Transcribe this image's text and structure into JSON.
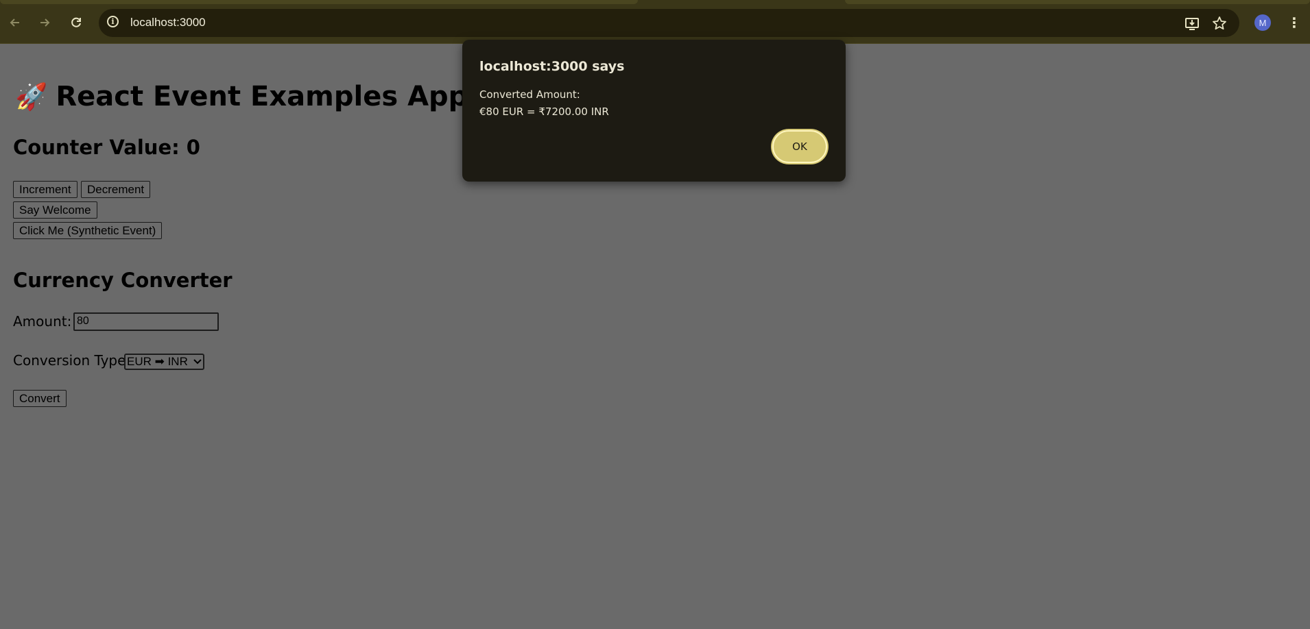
{
  "browser": {
    "url": "localhost:3000",
    "avatar_initial": "M",
    "icons": {
      "back": "arrow-left-icon",
      "forward": "arrow-right-icon",
      "reload": "reload-icon",
      "info": "info-icon",
      "install": "install-app-icon",
      "bookmark": "star-icon",
      "menu": "kebab-menu-icon"
    }
  },
  "app": {
    "title_emoji": "🚀",
    "title": "React Event Examples App",
    "counter_heading": "Counter Value: 0",
    "buttons": {
      "increment": "Increment",
      "decrement": "Decrement",
      "say_welcome": "Say Welcome",
      "synthetic": "Click Me (Synthetic Event)"
    },
    "converter": {
      "heading": "Currency Converter",
      "amount_label": "Amount:",
      "amount_value": "80",
      "type_label": "Conversion Type:",
      "type_selected": "EUR ➡ INR",
      "convert_button": "Convert"
    }
  },
  "dialog": {
    "title": "localhost:3000 says",
    "line1": "Converted Amount:",
    "line2": "€80 EUR = ₹7200.00 INR",
    "ok_label": "OK"
  },
  "colors": {
    "chrome_bg": "#3a3618",
    "page_overlay": "#6a6a6a",
    "dialog_bg": "#1d1b13",
    "ok_button": "#d6c974",
    "avatar": "#5567c9"
  }
}
